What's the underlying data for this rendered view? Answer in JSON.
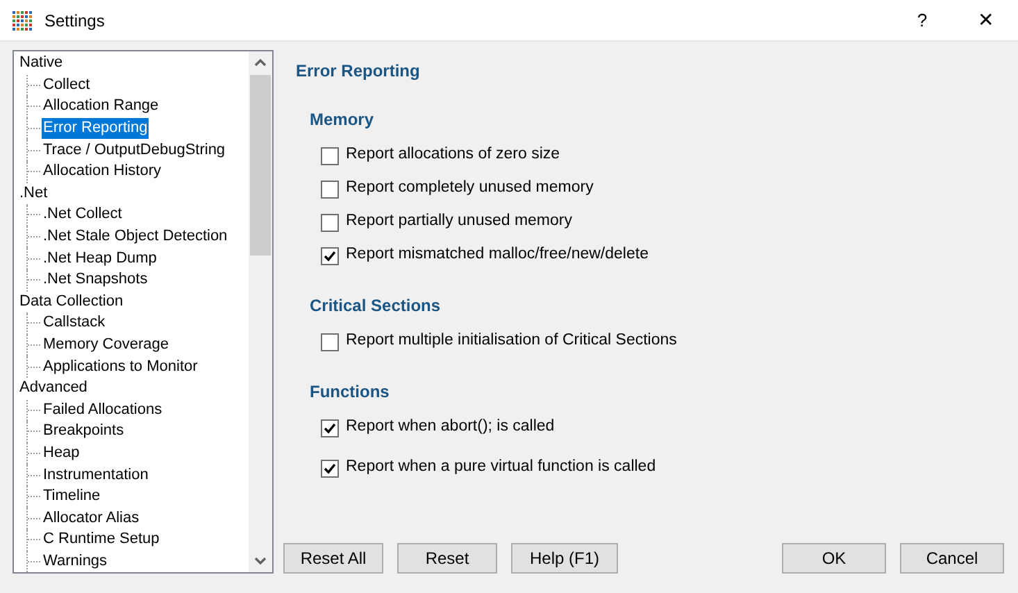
{
  "window": {
    "title": "Settings",
    "help": "?",
    "close": "✕"
  },
  "tree": [
    {
      "label": "Native",
      "selected": false,
      "children": [
        {
          "label": "Collect",
          "selected": false
        },
        {
          "label": "Allocation Range",
          "selected": false
        },
        {
          "label": "Error Reporting",
          "selected": true
        },
        {
          "label": "Trace / OutputDebugString",
          "selected": false
        },
        {
          "label": "Allocation History",
          "selected": false
        }
      ]
    },
    {
      "label": ".Net",
      "selected": false,
      "children": [
        {
          "label": ".Net Collect",
          "selected": false
        },
        {
          "label": ".Net Stale Object Detection",
          "selected": false
        },
        {
          "label": ".Net Heap Dump",
          "selected": false
        },
        {
          "label": ".Net Snapshots",
          "selected": false
        }
      ]
    },
    {
      "label": "Data Collection",
      "selected": false,
      "children": [
        {
          "label": "Callstack",
          "selected": false
        },
        {
          "label": "Memory Coverage",
          "selected": false
        },
        {
          "label": "Applications to Monitor",
          "selected": false
        }
      ]
    },
    {
      "label": "Advanced",
      "selected": false,
      "children": [
        {
          "label": "Failed Allocations",
          "selected": false
        },
        {
          "label": "Breakpoints",
          "selected": false
        },
        {
          "label": "Heap",
          "selected": false
        },
        {
          "label": "Instrumentation",
          "selected": false
        },
        {
          "label": "Timeline",
          "selected": false
        },
        {
          "label": "Allocator Alias",
          "selected": false
        },
        {
          "label": "C Runtime Setup",
          "selected": false
        },
        {
          "label": "Warnings",
          "selected": false
        }
      ]
    }
  ],
  "page_title": "Error Reporting",
  "sections": [
    {
      "title": "Memory",
      "options": [
        {
          "label": "Report allocations of zero size",
          "checked": false
        },
        {
          "label": "Report completely unused memory",
          "checked": false
        },
        {
          "label": "Report partially unused memory",
          "checked": false
        },
        {
          "label": "Report mismatched malloc/free/new/delete",
          "checked": true
        }
      ]
    },
    {
      "title": "Critical Sections",
      "options": [
        {
          "label": "Report multiple initialisation of Critical Sections",
          "checked": false
        }
      ]
    },
    {
      "title": "Functions",
      "options": [
        {
          "label": "Report when abort(); is called",
          "checked": true
        },
        {
          "label": "Report when a pure virtual function is called",
          "checked": true
        }
      ]
    }
  ],
  "left_buttons": [
    "Reset All",
    "Reset",
    "Help (F1)"
  ],
  "right_buttons": [
    "OK",
    "Cancel"
  ]
}
